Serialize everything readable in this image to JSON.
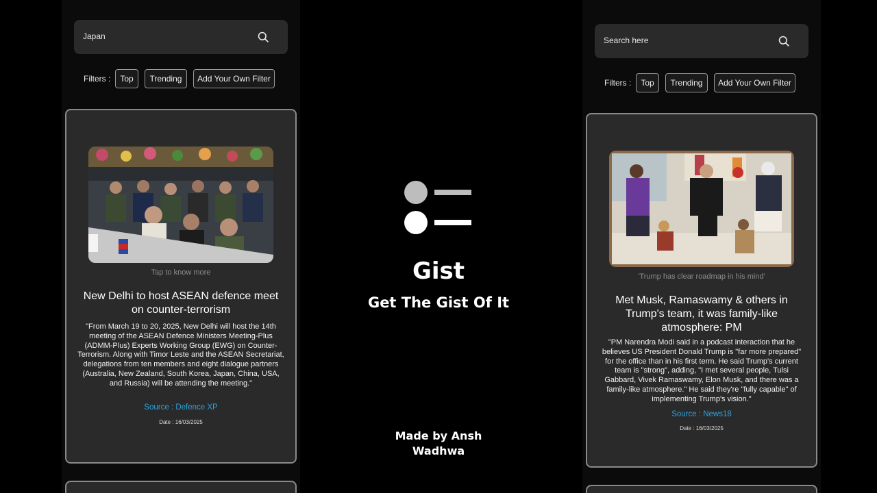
{
  "left_screen": {
    "search_value": "Japan",
    "filters_label": "Filters :",
    "filters": [
      "Top",
      "Trending",
      "Add Your Own Filter"
    ],
    "card": {
      "caption": "Tap to know more",
      "headline": "New Delhi to host ASEAN defence meet on counter-terrorism",
      "summary": "\"From March 19 to 20, 2025, New Delhi will host the 14th meeting of the ASEAN Defence Ministers Meeting-Plus (ADMM-Plus) Experts Working Group (EWG) on Counter-Terrorism. Along with Timor Leste and the ASEAN Secretariat, delegations from ten members and eight dialogue partners (Australia, New Zealand, South Korea, Japan, China, USA, and Russia) will be attending the meeting.\"",
      "source": "Source : Defence XP",
      "date": "Date : 16/03/2025"
    }
  },
  "center": {
    "title": "Gist",
    "tagline": "Get The Gist Of It",
    "credit": "Made by Ansh Wadhwa"
  },
  "right_screen": {
    "search_placeholder": "Search here",
    "filters_label": "Filters :",
    "filters": [
      "Top",
      "Trending",
      "Add Your Own Filter"
    ],
    "card": {
      "caption": "'Trump has clear roadmap in his mind'",
      "headline": "Met Musk, Ramaswamy & others in Trump's team, it was family-like atmosphere: PM",
      "summary": "\"PM Narendra Modi said in a podcast interaction that he believes US President Donald Trump is \"far more prepared\" for the office than in his first term. He said Trump's current team is \"strong\", adding, \"I met several people, Tulsi Gabbard, Vivek Ramaswamy, Elon Musk, and there was a family-like atmosphere.\" He said they're \"fully capable\" of implementing Trump's vision.\"",
      "source": "Source : News18",
      "date": "Date : 16/03/2025"
    }
  },
  "colors": {
    "background": "#000000",
    "card": "#2a2a2a",
    "source_link": "#2aa5e0",
    "caption": "#8e8e8e"
  },
  "icons": [
    "search-icon",
    "gist-logo-icon"
  ]
}
